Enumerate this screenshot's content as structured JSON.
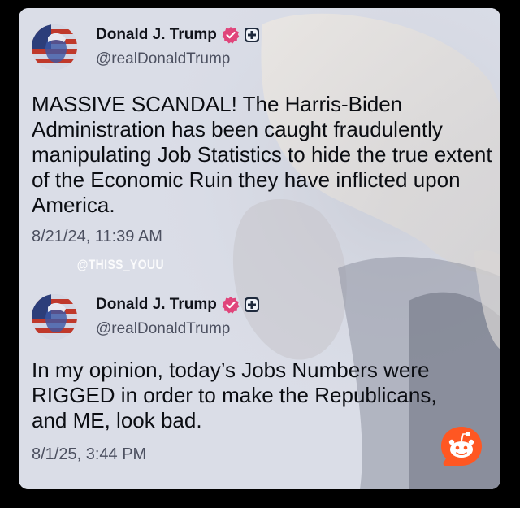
{
  "posts": [
    {
      "author": "Donald J. Trump",
      "handle": "@realDonaldTrump",
      "text": "MASSIVE SCANDAL! The Harris-Biden Administration has been caught fraudulently manipulating Job Statistics to hide the true extent of the Economic Ruin they have inflicted upon America.",
      "timestamp": "8/21/24, 11:39 AM"
    },
    {
      "author": "Donald J. Trump",
      "handle": "@realDonaldTrump",
      "text": "In my opinion, today’s Jobs Numbers were RIGGED in order to make the Republicans, and ME, look bad.",
      "timestamp": "8/1/25, 3:44 PM"
    }
  ],
  "watermark": "@THISS_YOUU",
  "colors": {
    "verified_badge": "#e0457b",
    "reddit_orange": "#ff5722",
    "card_background": "#dadde7"
  },
  "icons": [
    "verified-badge-icon",
    "plus-badge-icon",
    "reddit-snoo-icon",
    "flag-avatar"
  ]
}
